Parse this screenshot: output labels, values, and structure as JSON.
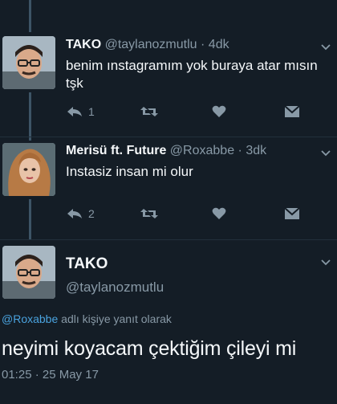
{
  "tweets": [
    {
      "name": "TAKO",
      "handle": "@taylanozmutlu",
      "time": "· 4dk",
      "text_line1": "benim ınstagramım yok buraya atar mısın",
      "text_line2": "tşk",
      "reply_count": "1"
    },
    {
      "name": "Merisü ft. Future",
      "handle": "@Roxabbe",
      "time": "· 3dk",
      "text_line1": "Instasiz insan mi olur",
      "reply_count": "2"
    }
  ],
  "main_tweet": {
    "name": "TAKO",
    "handle": "@taylanozmutlu",
    "reply_to_mention": "@Roxabbe",
    "reply_to_suffix": " adlı kişiye yanıt olarak",
    "text": "neyimi koyacam çektiğim çileyi mi",
    "timestamp": "01:25 · 25 May 17"
  },
  "colors": {
    "background": "#141d26",
    "secondary_text": "#8899a6",
    "link": "#4aa3df"
  },
  "icons": [
    "reply-icon",
    "retweet-icon",
    "like-icon",
    "dm-icon",
    "chevron-down-icon"
  ]
}
